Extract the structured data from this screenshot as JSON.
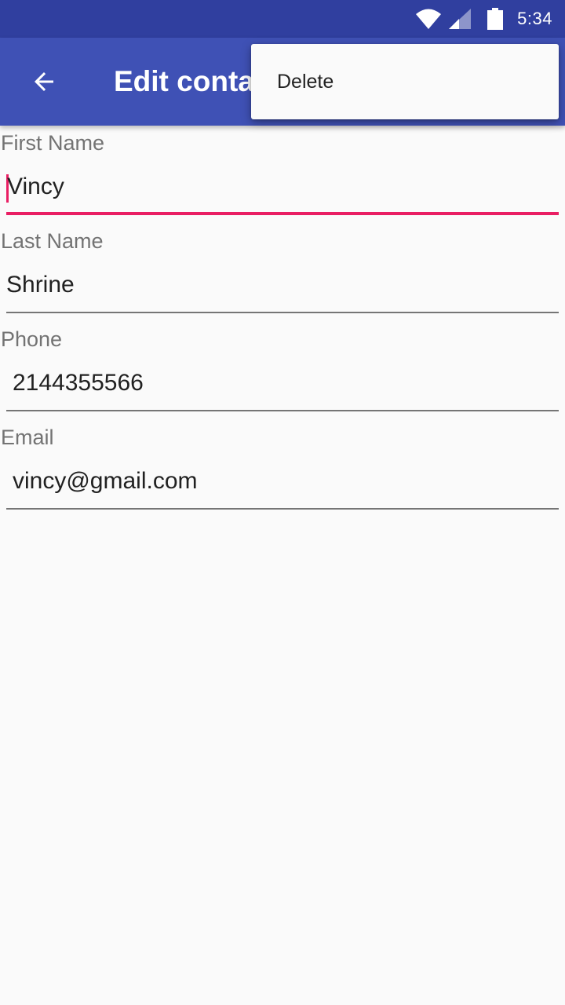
{
  "status_bar": {
    "time": "5:34",
    "icons": [
      "wifi-icon",
      "cell-signal-icon",
      "battery-icon"
    ]
  },
  "app_bar": {
    "back_icon": "arrow-back-icon",
    "title": "Edit contact"
  },
  "overflow_menu": {
    "items": [
      {
        "label": "Delete"
      }
    ]
  },
  "form": {
    "fields": [
      {
        "label": "First Name",
        "value": "Vincy",
        "focused": true
      },
      {
        "label": "Last Name",
        "value": "Shrine",
        "focused": false
      },
      {
        "label": "Phone",
        "value": "2144355566",
        "focused": false
      },
      {
        "label": "Email",
        "value": "vincy@gmail.com",
        "focused": false
      }
    ]
  },
  "colors": {
    "status_bar": "#303f9f",
    "primary": "#3f51b5",
    "accent": "#e91e63",
    "background": "#fafafa"
  }
}
